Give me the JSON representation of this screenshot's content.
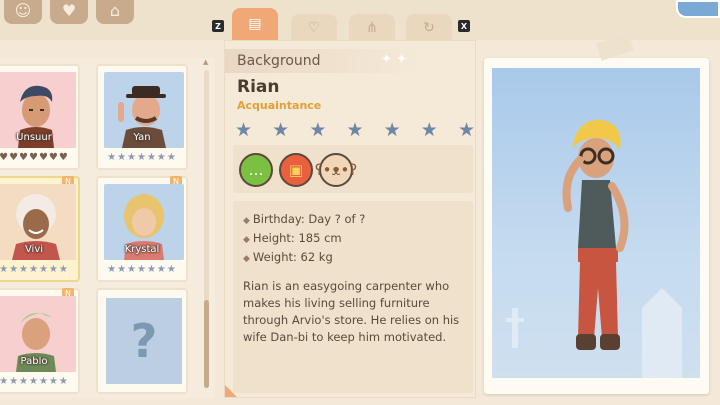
{
  "nav": {
    "buttons": [
      {
        "icon": "people-icon"
      },
      {
        "icon": "heart-icon"
      },
      {
        "icon": "home-icon"
      }
    ]
  },
  "tabs": {
    "left_key": "Z",
    "right_key": "X",
    "items": [
      {
        "icon": "document-icon",
        "active": true
      },
      {
        "icon": "heart-icon",
        "active": false
      },
      {
        "icon": "network-icon",
        "active": false
      },
      {
        "icon": "cycle-icon",
        "active": false
      }
    ]
  },
  "characters": [
    {
      "name": "Unsuur",
      "rating_type": "hearts",
      "rating": "♥♥♥♥♥♥♥",
      "badge": ""
    },
    {
      "name": "Yan",
      "rating_type": "stars",
      "rating": "★★★★★★★",
      "badge": ""
    },
    {
      "name": "Vivi",
      "rating_type": "stars",
      "rating": "★★★★★★★",
      "badge": "N",
      "selected": true
    },
    {
      "name": "Krystal",
      "rating_type": "stars",
      "rating": "★★★★★★★",
      "badge": "N"
    },
    {
      "name": "Pablo",
      "rating_type": "stars",
      "rating": "★★★★★★★",
      "badge": "N"
    },
    {
      "name": "",
      "rating_type": "unknown",
      "rating": "",
      "placeholder": "?"
    }
  ],
  "profile": {
    "section_title": "Background",
    "name": "Rian",
    "relation": "Acquaintance",
    "stars": [
      "★",
      "★",
      "★",
      "★",
      "★",
      "★",
      "★"
    ],
    "likes": [
      {
        "icon": "chat-bubble-icon",
        "bg": "#7bc043"
      },
      {
        "icon": "gift-box-icon",
        "bg": "#e9603f"
      },
      {
        "icon": "teddy-bear-icon",
        "bg": "#f1d7b8"
      }
    ],
    "details": {
      "birthday": "Birthday: Day ? of ?",
      "height": "Height: 185 cm",
      "weight": "Weight: 62 kg"
    },
    "description": "Rian is an easygoing carpenter who makes his living selling furniture through Arvio's store. He relies on his wife Dan-bi to keep him motivated."
  },
  "colors": {
    "accent": "#f0a877",
    "relation": "#e0a136",
    "star": "#6f86a6",
    "panel": "#f5ead8"
  }
}
